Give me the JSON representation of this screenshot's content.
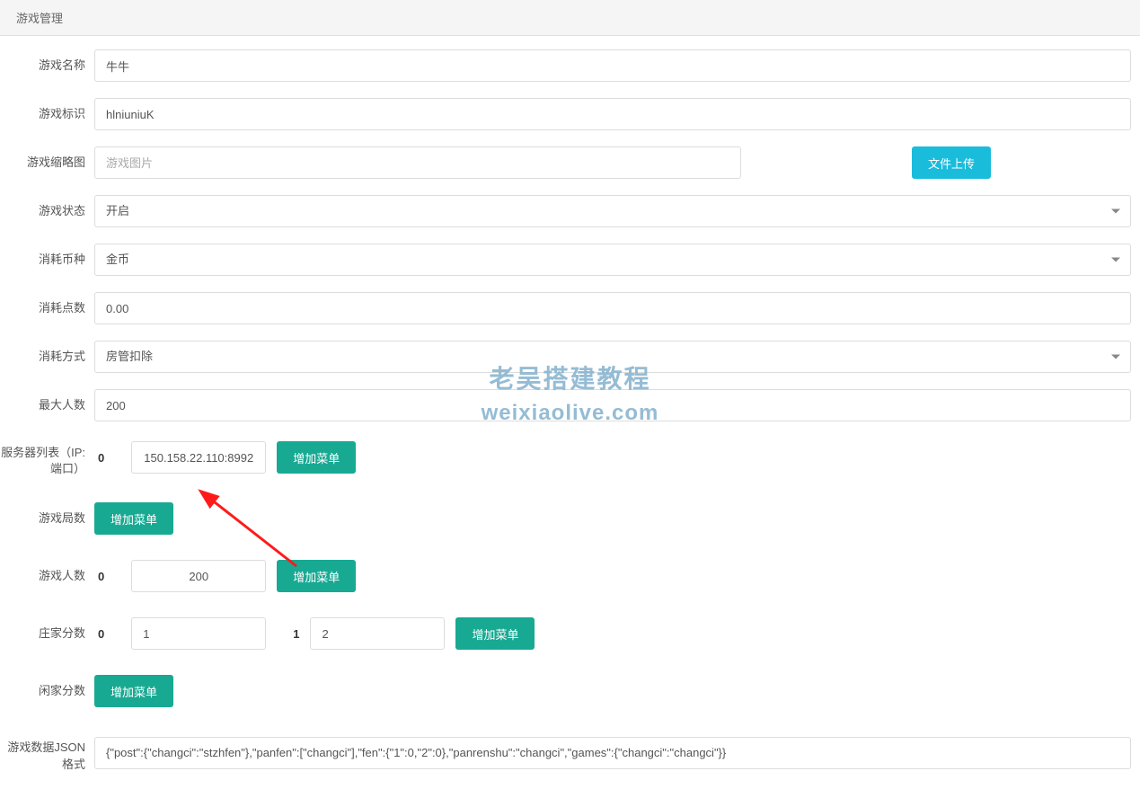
{
  "header": {
    "title": "游戏管理"
  },
  "form": {
    "gameName": {
      "label": "游戏名称",
      "value": "牛牛"
    },
    "gameId": {
      "label": "游戏标识",
      "value": "hlniuniuK"
    },
    "thumbnail": {
      "label": "游戏缩略图",
      "placeholder": "游戏图片",
      "uploadBtn": "文件上传"
    },
    "status": {
      "label": "游戏状态",
      "value": "开启"
    },
    "currency": {
      "label": "消耗币种",
      "value": "金币"
    },
    "points": {
      "label": "消耗点数",
      "value": "0.00"
    },
    "method": {
      "label": "消耗方式",
      "value": "房管扣除"
    },
    "maxPlayers": {
      "label": "最大人数",
      "value": "200"
    },
    "serverList": {
      "label": "服务器列表（IP:端口）",
      "items": [
        {
          "index": "0",
          "value": "150.158.22.110:8992"
        }
      ],
      "addBtn": "增加菜单"
    },
    "rounds": {
      "label": "游戏局数",
      "addBtn": "增加菜单"
    },
    "players": {
      "label": "游戏人数",
      "items": [
        {
          "index": "0",
          "value": "200"
        }
      ],
      "addBtn": "增加菜单"
    },
    "dealerScore": {
      "label": "庄家分数",
      "items": [
        {
          "index": "0",
          "value": "1"
        },
        {
          "index": "1",
          "value": "2"
        }
      ],
      "addBtn": "增加菜单"
    },
    "playerScore": {
      "label": "闲家分数",
      "addBtn": "增加菜单"
    },
    "jsonData": {
      "label": "游戏数据JSON格式",
      "value": "{\"post\":{\"changci\":\"stzhfen\"},\"panfen\":[\"changci\"],\"fen\":{\"1\":0,\"2\":0},\"panrenshu\":\"changci\",\"games\":{\"changci\":\"changci\"}}"
    }
  },
  "watermark": {
    "line1": "老吴搭建教程",
    "line2": "weixiaolive.com"
  }
}
